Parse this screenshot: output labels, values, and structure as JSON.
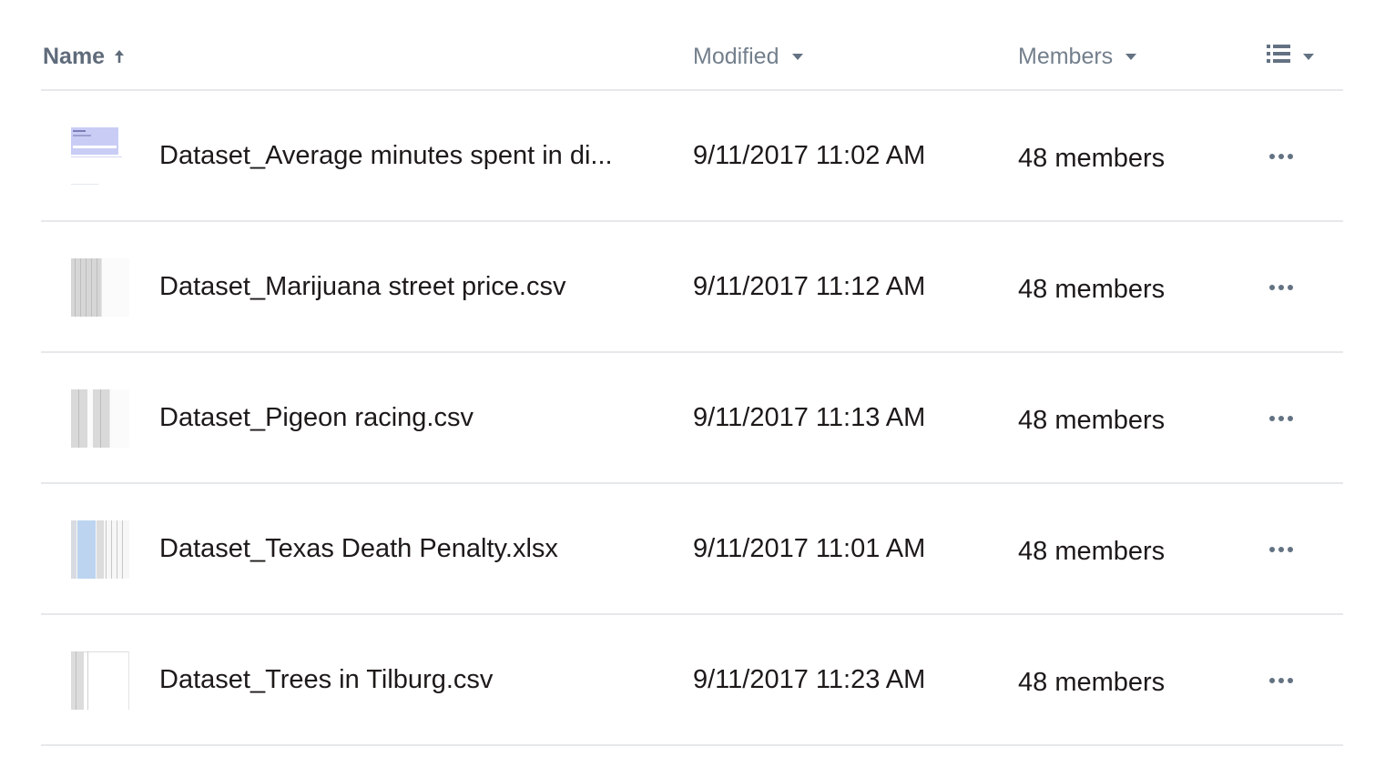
{
  "header": {
    "name_label": "Name",
    "modified_label": "Modified",
    "members_label": "Members",
    "view_options_icon": "list-view-icon"
  },
  "colors": {
    "text": "#1e1919",
    "header_text": "#737f8c",
    "divider": "#e6e8eb",
    "icon": "#637282"
  },
  "files": [
    {
      "name": "Dataset_Average minutes spent in di...",
      "modified": "9/11/2017 11:02 AM",
      "members": "48 members",
      "thumb": "doc-blue-preview"
    },
    {
      "name": "Dataset_Marijuana street price.csv",
      "modified": "9/11/2017 11:12 AM",
      "members": "48 members",
      "thumb": "csv-preview"
    },
    {
      "name": "Dataset_Pigeon racing.csv",
      "modified": "9/11/2017 11:13 AM",
      "members": "48 members",
      "thumb": "csv-preview"
    },
    {
      "name": "Dataset_Texas Death Penalty.xlsx",
      "modified": "9/11/2017 11:01 AM",
      "members": "48 members",
      "thumb": "xlsx-preview"
    },
    {
      "name": "Dataset_Trees in Tilburg.csv",
      "modified": "9/11/2017 11:23 AM",
      "members": "48 members",
      "thumb": "csv-preview"
    }
  ]
}
